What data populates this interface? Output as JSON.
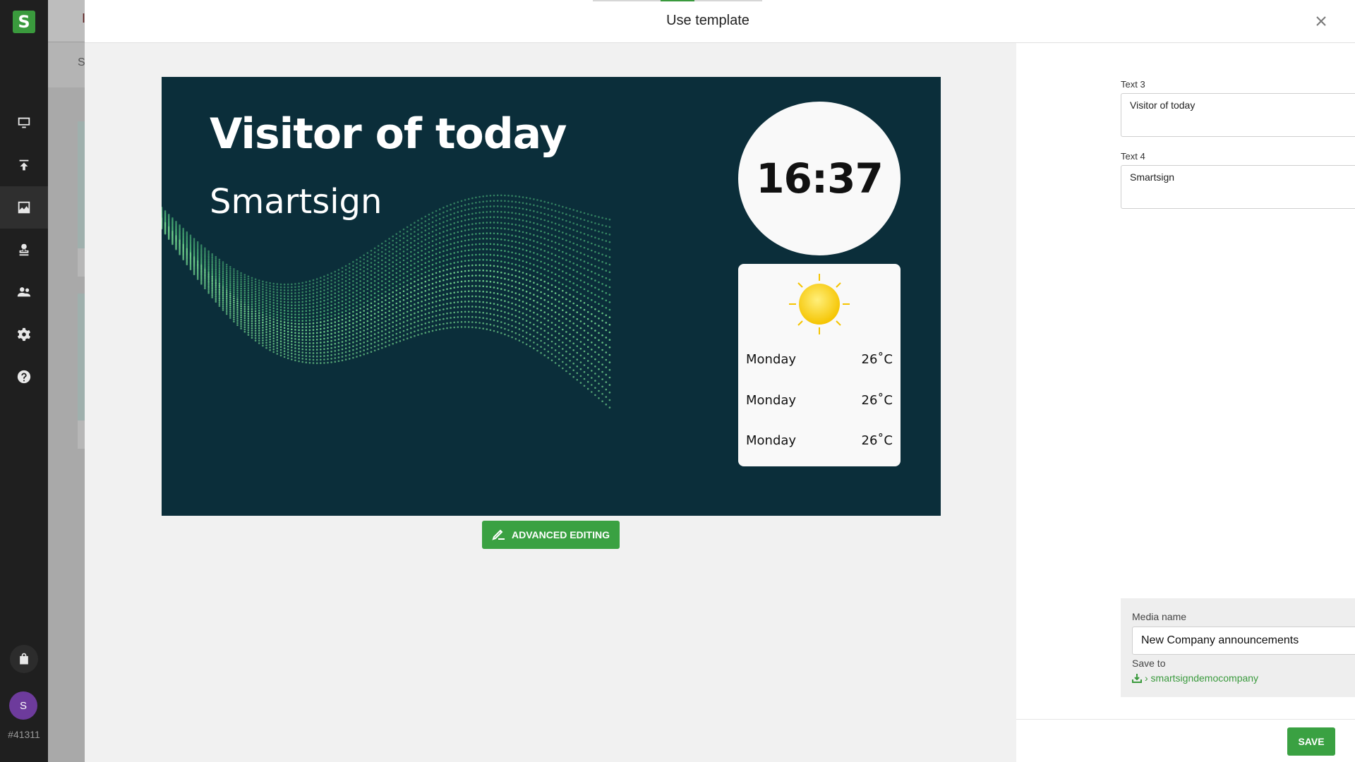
{
  "sidebar": {
    "logo_letter": "S",
    "items": [
      {
        "icon": "monitor-icon"
      },
      {
        "icon": "upload-icon"
      },
      {
        "icon": "image-icon",
        "active": true
      },
      {
        "icon": "stamp-icon"
      },
      {
        "icon": "users-icon"
      },
      {
        "icon": "gear-icon"
      },
      {
        "icon": "help-icon"
      }
    ],
    "avatar_initial": "S",
    "account_id": "#41311"
  },
  "background": {
    "header_letter": "I",
    "subbar_letter": "S"
  },
  "modal": {
    "title": "Use template"
  },
  "preview": {
    "title": "Visitor of today",
    "subtitle": "Smartsign",
    "clock": "16:37",
    "weather": [
      {
        "day": "Monday",
        "temp": "26˚C"
      },
      {
        "day": "Monday",
        "temp": "26˚C"
      },
      {
        "day": "Monday",
        "temp": "26˚C"
      }
    ],
    "background_color": "#0b2e3a"
  },
  "advanced_editing_label": "ADVANCED EDITING",
  "panel": {
    "text3": {
      "label": "Text 3",
      "value": "Visitor of today"
    },
    "text4": {
      "label": "Text 4",
      "value": "Smartsign"
    },
    "media_name_label": "Media name",
    "media_name_value": "New Company announcements",
    "save_to_label": "Save to",
    "save_to_path": "› smartsigndemocompany"
  },
  "save_label": "SAVE",
  "colors": {
    "accent": "#3aa142",
    "sidebar": "#1f1f1f"
  }
}
